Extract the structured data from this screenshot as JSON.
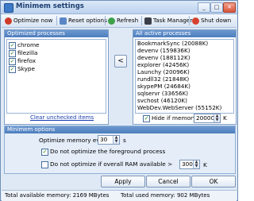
{
  "window": {
    "title": "Minimem settings",
    "minimize_glyph": "_",
    "maximize_glyph": "□",
    "close_glyph": "✕"
  },
  "toolbar": {
    "optimize_now": "Optimize now",
    "reset_options": "Reset options",
    "refresh": "Refresh",
    "task_manager": "Task Manager",
    "shut_down": "Shut down"
  },
  "optimized": {
    "header": "Optimized processes",
    "items": [
      {
        "label": "chrome",
        "checked": true
      },
      {
        "label": "filezilla",
        "checked": true
      },
      {
        "label": "firefox",
        "checked": true
      },
      {
        "label": "Skype",
        "checked": true
      }
    ],
    "clear_link": "Clear unchecked items"
  },
  "move_button": "<",
  "active": {
    "header": "All active processes",
    "items": [
      "BookmarkSync (20088K)",
      "devenv (159836K)",
      "devenv (188112K)",
      "explorer (42456K)",
      "Launchy (20096K)",
      "rundll32 (21848K)",
      "skypePM (24684K)",
      "sqlservr (33656K)",
      "svchost (46120K)",
      "WebDev.WebServer (55152K)"
    ],
    "hide_label": "Hide if memory",
    "hide_operator": "<",
    "hide_value": "20000",
    "hide_unit": "K",
    "hide_checked": true
  },
  "options": {
    "header": "Minimem options",
    "every_label": "Optimize memory every",
    "every_value": "30",
    "every_unit": "s",
    "foreground_label": "Do not optimize the foreground process",
    "foreground_checked": true,
    "ram_label": "Do not optimize if overall RAM available >",
    "ram_checked": false,
    "ram_value": "300",
    "ram_unit": "K"
  },
  "buttons": {
    "apply": "Apply",
    "cancel": "Cancel",
    "ok": "OK"
  },
  "status": {
    "available": "Total available memory: 2169 MBytes",
    "used": "Total used memory: 902 MBytes"
  },
  "colors": {
    "accent": "#4d7dbd",
    "link": "#1a3fb0",
    "check": "#1b8a1b"
  },
  "icons": [
    "app-icon",
    "optimize-icon",
    "reset-icon",
    "refresh-icon",
    "task-manager-icon",
    "shut-down-icon"
  ]
}
